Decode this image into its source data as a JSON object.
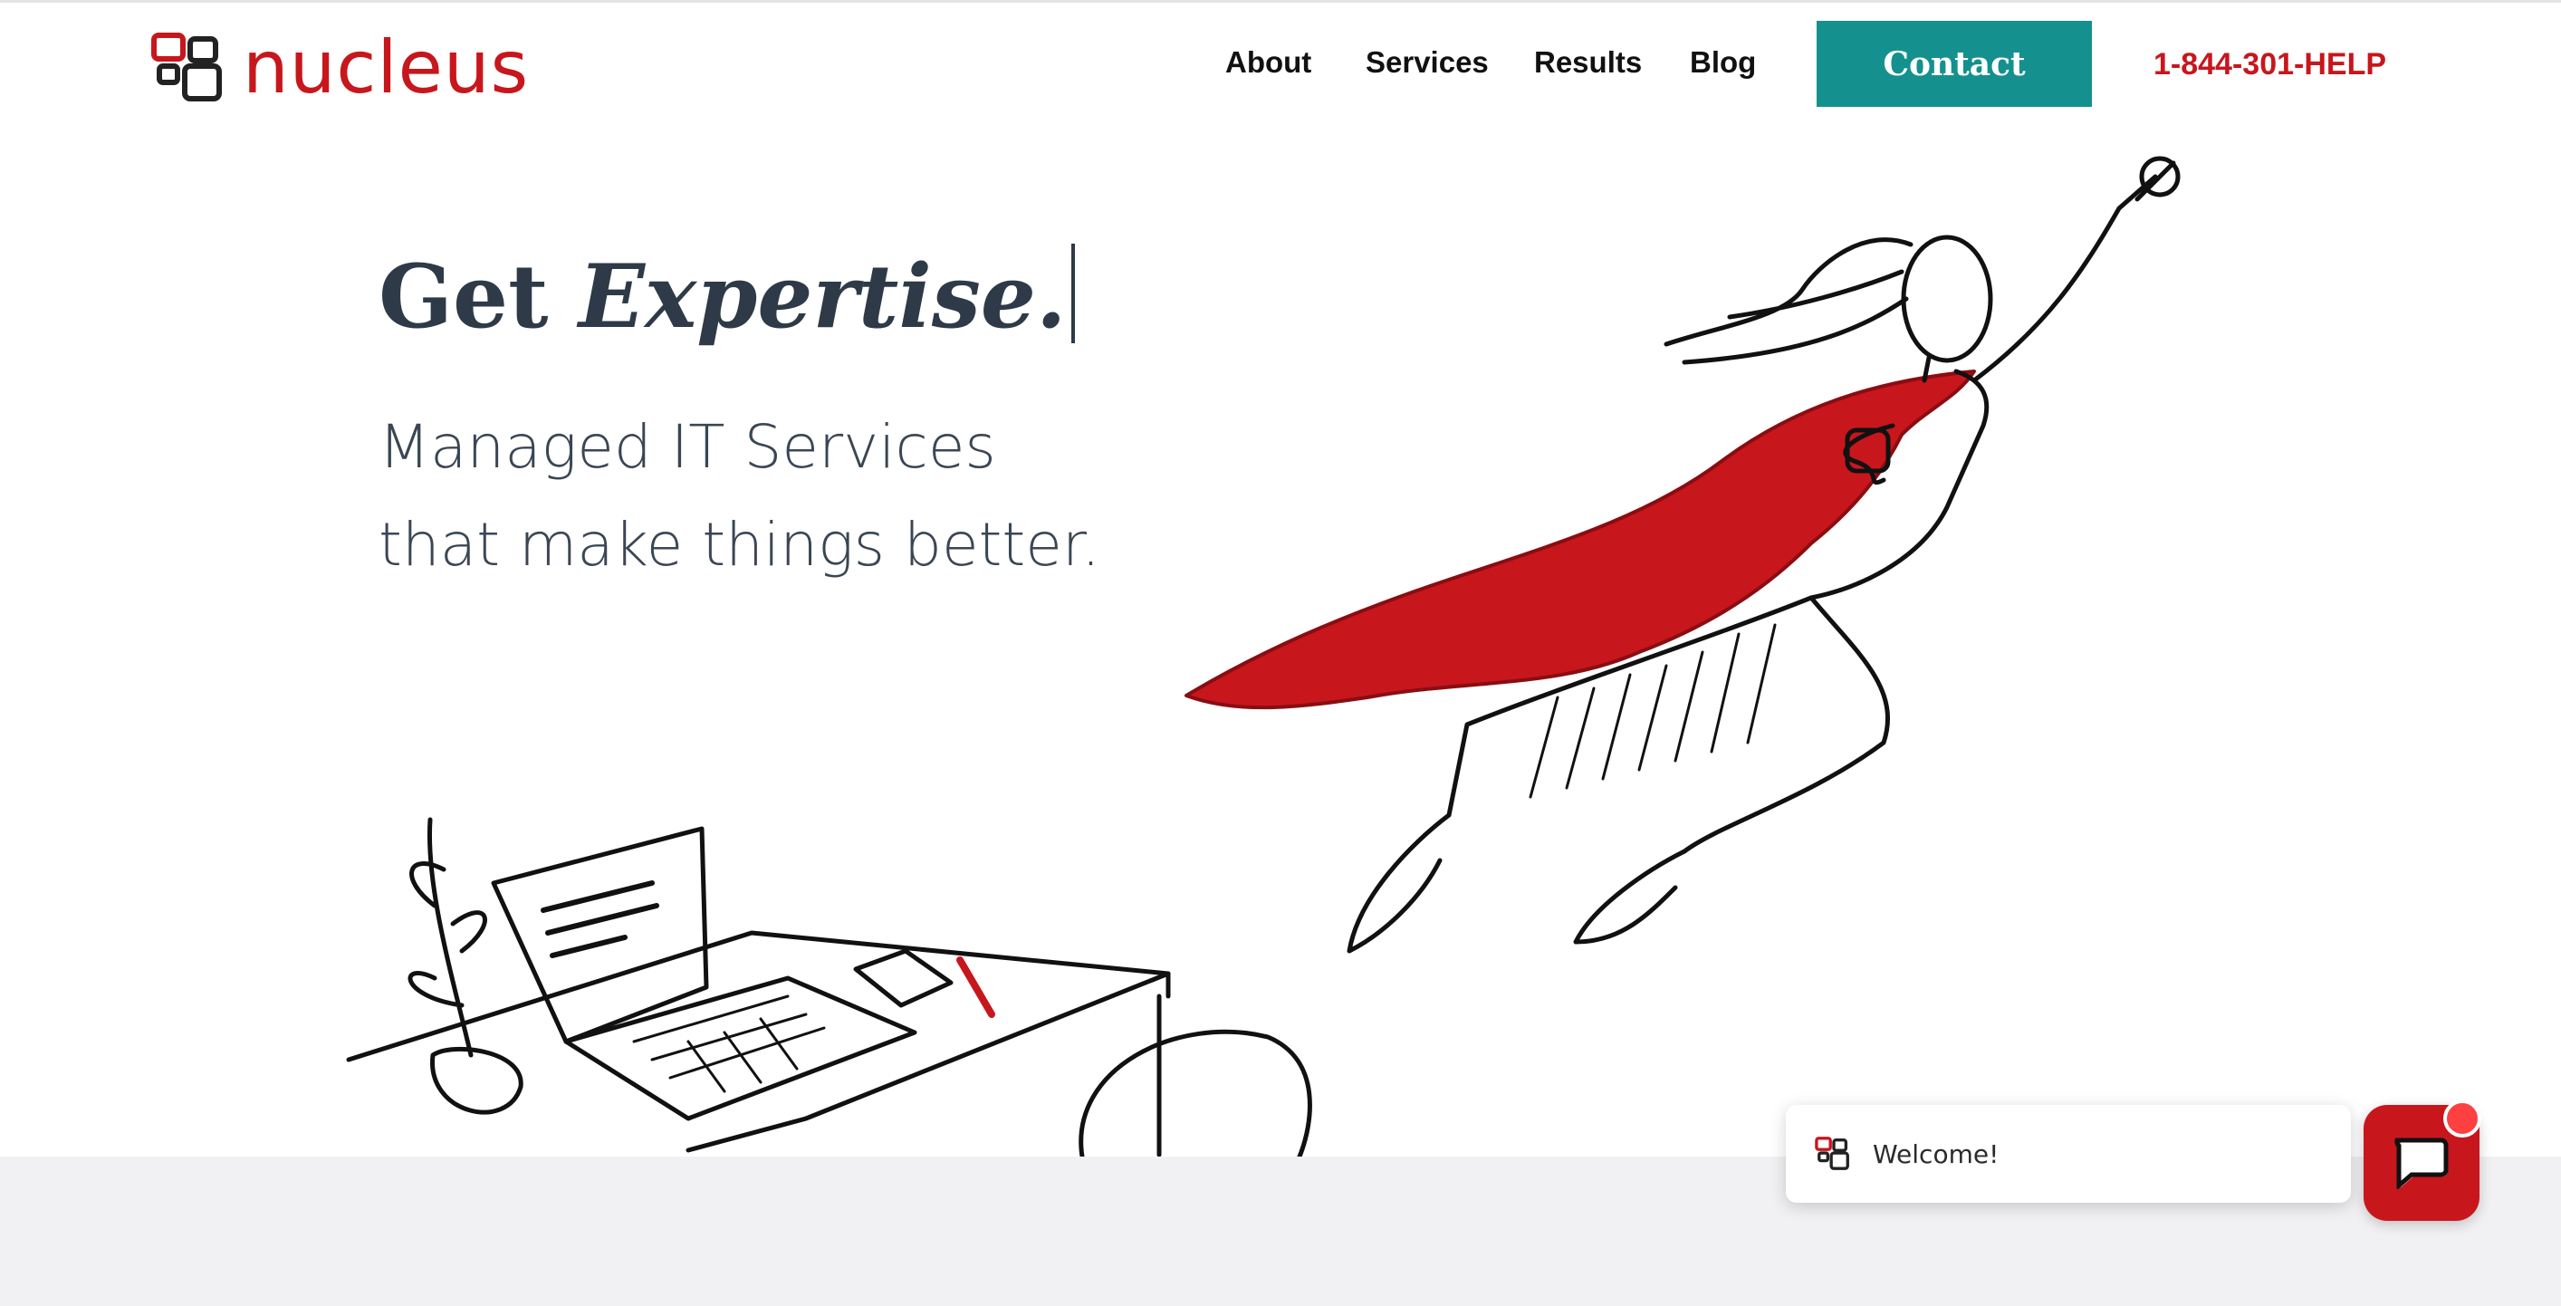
{
  "header": {
    "logo_text": "nucleus",
    "nav": [
      "About",
      "Services",
      "Results",
      "Blog"
    ],
    "contact_label": "Contact",
    "phone": "1-844-301-HELP"
  },
  "hero": {
    "heading_plain": "Get ",
    "heading_em": "Expertise.",
    "subheading": "Managed IT Services that make things better."
  },
  "chat": {
    "welcome_text": "Welcome!"
  },
  "colors": {
    "brand_red": "#c8161d",
    "contact_teal": "#14918e",
    "heading_text": "#2e3a48",
    "bottom_band": "#f1f1f3"
  },
  "icons": {
    "logo": "nucleus-squares-logo-icon",
    "chat": "chat-bubble-icon"
  }
}
